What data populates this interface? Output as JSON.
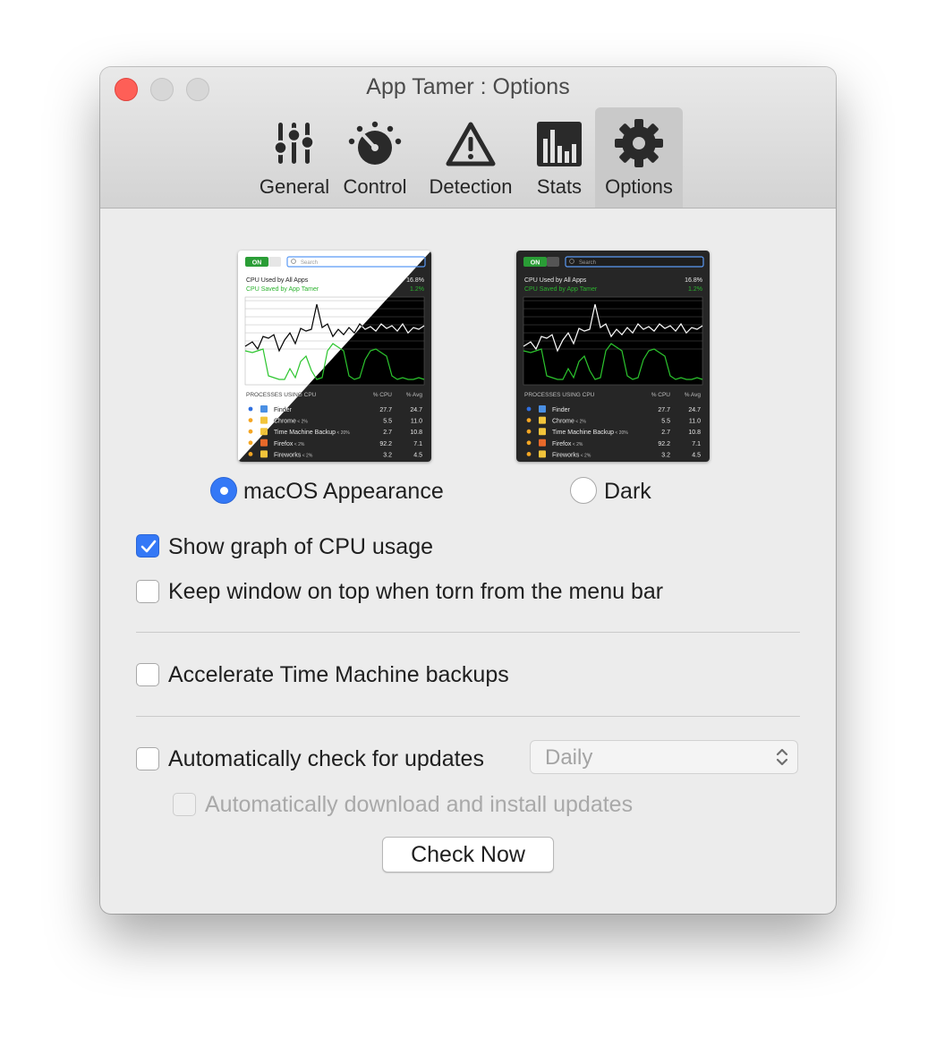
{
  "window": {
    "title": "App Tamer : Options"
  },
  "toolbar": {
    "tabs": [
      {
        "label": "General",
        "icon": "sliders-icon"
      },
      {
        "label": "Control",
        "icon": "gauge-icon"
      },
      {
        "label": "Detection",
        "icon": "warning-icon"
      },
      {
        "label": "Stats",
        "icon": "bar-chart-icon"
      },
      {
        "label": "Options",
        "icon": "gear-icon",
        "selected": true
      }
    ]
  },
  "appearance": {
    "options": [
      {
        "label": "macOS Appearance",
        "selected": true
      },
      {
        "label": "Dark",
        "selected": false
      }
    ],
    "preview": {
      "toggle": "ON",
      "search_placeholder": "Search",
      "cpu_used_label": "CPU Used by All Apps",
      "cpu_used_value": "16.8%",
      "cpu_saved_label": "CPU Saved by App Tamer",
      "cpu_saved_value": "1.2%",
      "processes_header": "PROCESSES USING CPU",
      "col_cpu": "% CPU",
      "col_avg": "% Avg",
      "processes": [
        {
          "name": "Finder",
          "suffix": "",
          "cpu": "27.7",
          "avg": "24.7",
          "dot": "#2f6fe0"
        },
        {
          "name": "Chrome",
          "suffix": "< 2%",
          "cpu": "5.5",
          "avg": "11.0",
          "dot": "#f5a623"
        },
        {
          "name": "Time Machine Backup",
          "suffix": "< 20%",
          "cpu": "2.7",
          "avg": "10.8",
          "dot": "#f5a623"
        },
        {
          "name": "Firefox",
          "suffix": "< 2%",
          "cpu": "92.2",
          "avg": "7.1",
          "dot": "#f5a623"
        },
        {
          "name": "Fireworks",
          "suffix": "< 2%",
          "cpu": "3.2",
          "avg": "4.5",
          "dot": "#f5a623"
        }
      ]
    }
  },
  "options": {
    "show_graph": {
      "label": "Show graph of CPU usage",
      "checked": true
    },
    "keep_on_top": {
      "label": "Keep window on top when torn from the menu bar",
      "checked": false
    },
    "accelerate_tm": {
      "label": "Accelerate Time Machine backups",
      "checked": false
    },
    "auto_check": {
      "label": "Automatically check for updates",
      "checked": false
    },
    "frequency": {
      "value": "Daily"
    },
    "auto_download": {
      "label": "Automatically download and install updates",
      "checked": false,
      "disabled": true
    },
    "check_now": {
      "label": "Check Now"
    }
  },
  "colors": {
    "accent": "#3478f6",
    "close": "#fe5f57",
    "graph_green": "#27c22a"
  }
}
